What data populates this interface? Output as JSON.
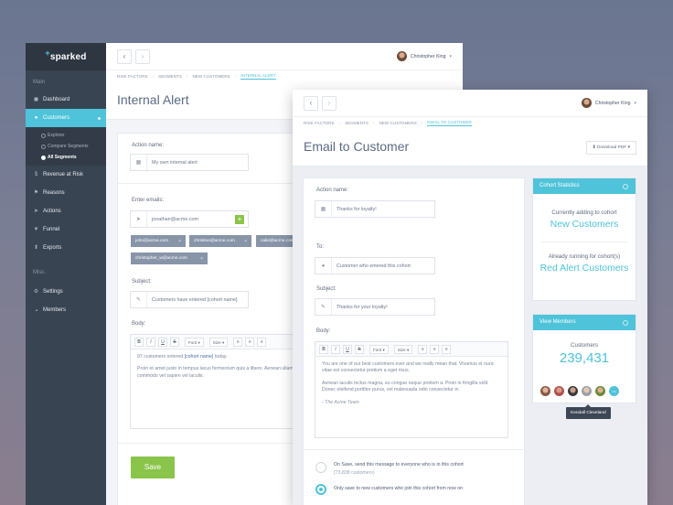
{
  "sidebar": {
    "logo_mark": "+",
    "logo": "sparked",
    "main_section": "Main",
    "items_main": [
      {
        "label": "Dashboard",
        "icon": "dashboard-icon",
        "glyph": "◼"
      },
      {
        "label": "Customers",
        "icon": "user-icon",
        "glyph": "●"
      }
    ],
    "subitems": [
      "Explorer",
      "Compare Segments",
      "All Segments"
    ],
    "items_more": [
      {
        "label": "Revenue at Risk",
        "icon": "dollar-icon",
        "glyph": "$"
      },
      {
        "label": "Reasons",
        "icon": "flag-icon",
        "glyph": "⚑"
      },
      {
        "label": "Actions",
        "icon": "send-icon",
        "glyph": "➤"
      },
      {
        "label": "Funnel",
        "icon": "filter-icon",
        "glyph": "▼"
      },
      {
        "label": "Exports",
        "icon": "export-icon",
        "glyph": "⬆"
      }
    ],
    "misc_section": "Misc.",
    "items_misc": [
      {
        "label": "Settings",
        "icon": "gear-icon",
        "glyph": "⚙"
      },
      {
        "label": "Members",
        "icon": "users-icon",
        "glyph": "●●"
      }
    ]
  },
  "window1": {
    "user_name": "Christopher King",
    "breadcrumb": [
      "RISK FACTORS",
      "SEGMENTS",
      "NEW CUSTOMERS",
      "INTERNAL ALERT"
    ],
    "title": "Internal Alert",
    "action_name_label": "Action name:",
    "action_name_value": "My own internal alert",
    "emails_label": "Enter emails:",
    "email_input_value": "jonathan@acme.com",
    "email_chips": [
      "john@acme.com",
      "christine@acme.com",
      "calie@acme.com",
      "christopher_w@acme.com"
    ],
    "subject_label": "Subject:",
    "subject_value": "Customers have entered [cohort name]",
    "body_label": "Body:",
    "toolbar": {
      "bold": "B",
      "italic": "I",
      "underline": "U",
      "strike": "S",
      "font": "Font",
      "size": "Size"
    },
    "body_p1_pre": "97 customers entered",
    "body_p1_var": "[cohort name]",
    "body_p1_post": "today.",
    "body_p2": "Proin et amet justo in tempus lacus fermentum quis a libero. Aenean ullamcorper ex lobortis tempor. Aliquam sollicitudin purus a pretium iaculis. Suspendisse commodo vel sapien vel iaculis.",
    "save_label": "Save"
  },
  "window2": {
    "user_name": "Christopher King",
    "breadcrumb": [
      "RISK FACTORS",
      "SEGMENTS",
      "NEW CUSTOMERS",
      "EMAIL TO CUSTOMER"
    ],
    "title": "Email to Customer",
    "download_label": "Download PDF",
    "action_name_label": "Action name:",
    "action_name_value": "Thanks for loyalty!",
    "to_label": "To:",
    "to_value": "Customer who entered this cohort",
    "subject_label": "Subject:",
    "subject_value": "Thanks for your loyalty!",
    "body_label": "Body:",
    "toolbar": {
      "bold": "B",
      "italic": "I",
      "underline": "U",
      "strike": "S",
      "font": "Font",
      "size": "Size"
    },
    "body_p1": "You are one of our best customers ever and we really mean that. Vivamus et nunc vitae est consectetur pretium a eget risus.",
    "body_p2": "Aenean iaculis lectus magna, eu congue neque pretium a. Proin in fringilla velit. Donec eleifend porttitor purus, vel malesuada odio consectetur in.",
    "body_sign": "- The Acme Team",
    "option1": "On Save, send this message to everyone who is in this cohort",
    "option1_sub": "(73,838 customers)",
    "option2": "Only save to new customers who join this cohort from now on",
    "cohort_panel_title": "Cohort Statistics",
    "adding_label": "Currently adding to cohort",
    "adding_value": "New Customers",
    "running_label": "Already running for cohort(s)",
    "running_value": "Red Alert Customers",
    "members_panel_title": "View Members",
    "customers_label": "Customers",
    "customers_value": "239,431",
    "tooltip": "Kendall Cleveland",
    "more_glyph": "•••"
  }
}
